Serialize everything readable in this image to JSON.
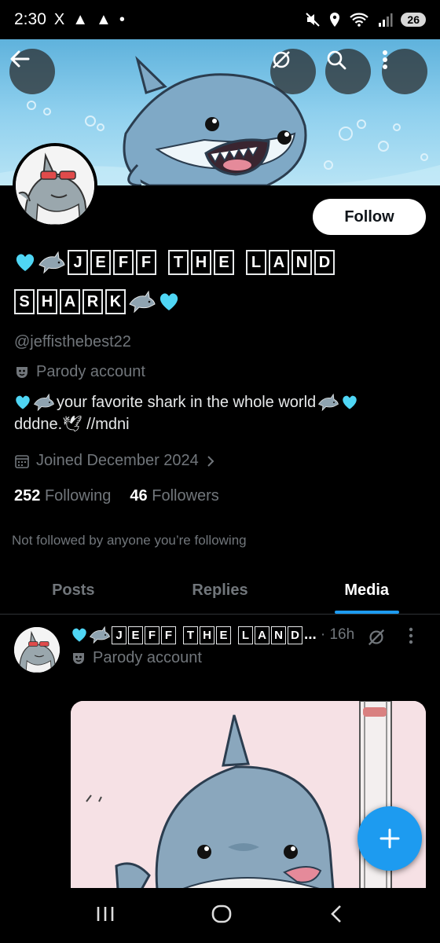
{
  "status_bar": {
    "time": "2:30",
    "battery": "26",
    "notifications": [
      "X",
      "▲",
      "▲",
      "•"
    ]
  },
  "profile": {
    "name_line1": [
      "J",
      "E",
      "F",
      "F",
      " ",
      "T",
      "H",
      "E",
      " ",
      "L",
      "A",
      "N",
      "D"
    ],
    "name_line2": [
      "S",
      "H",
      "A",
      "R",
      "K"
    ],
    "handle": "@jeffisthebest22",
    "parody_label": "Parody account",
    "bio_line1": "your favorite shark in the whole world",
    "bio_line2": "dddne.🕊 //mdni",
    "joined": "Joined December 2024",
    "following_count": "252",
    "following_label": "Following",
    "followers_count": "46",
    "followers_label": "Followers",
    "not_followed": "Not followed by anyone you’re following",
    "follow_button": "Follow"
  },
  "tabs": [
    {
      "label": "Posts",
      "active": false
    },
    {
      "label": "Replies",
      "active": false
    },
    {
      "label": "Media",
      "active": true
    }
  ],
  "post": {
    "name_chars": [
      "J",
      "E",
      "F",
      "F",
      " ",
      "T",
      "H",
      "E",
      " ",
      "L",
      "A",
      "N",
      "D"
    ],
    "ellipsis": "...",
    "time": "· 16h",
    "parody_label": "Parody account"
  },
  "colors": {
    "accent": "#1d9bf0",
    "heart": "#4fd6f5",
    "muted": "#71767b"
  },
  "icons": {
    "back": "back-arrow-icon",
    "grok": "grok-icon",
    "search": "search-icon",
    "more": "more-vertical-icon",
    "compose": "plus-icon"
  }
}
